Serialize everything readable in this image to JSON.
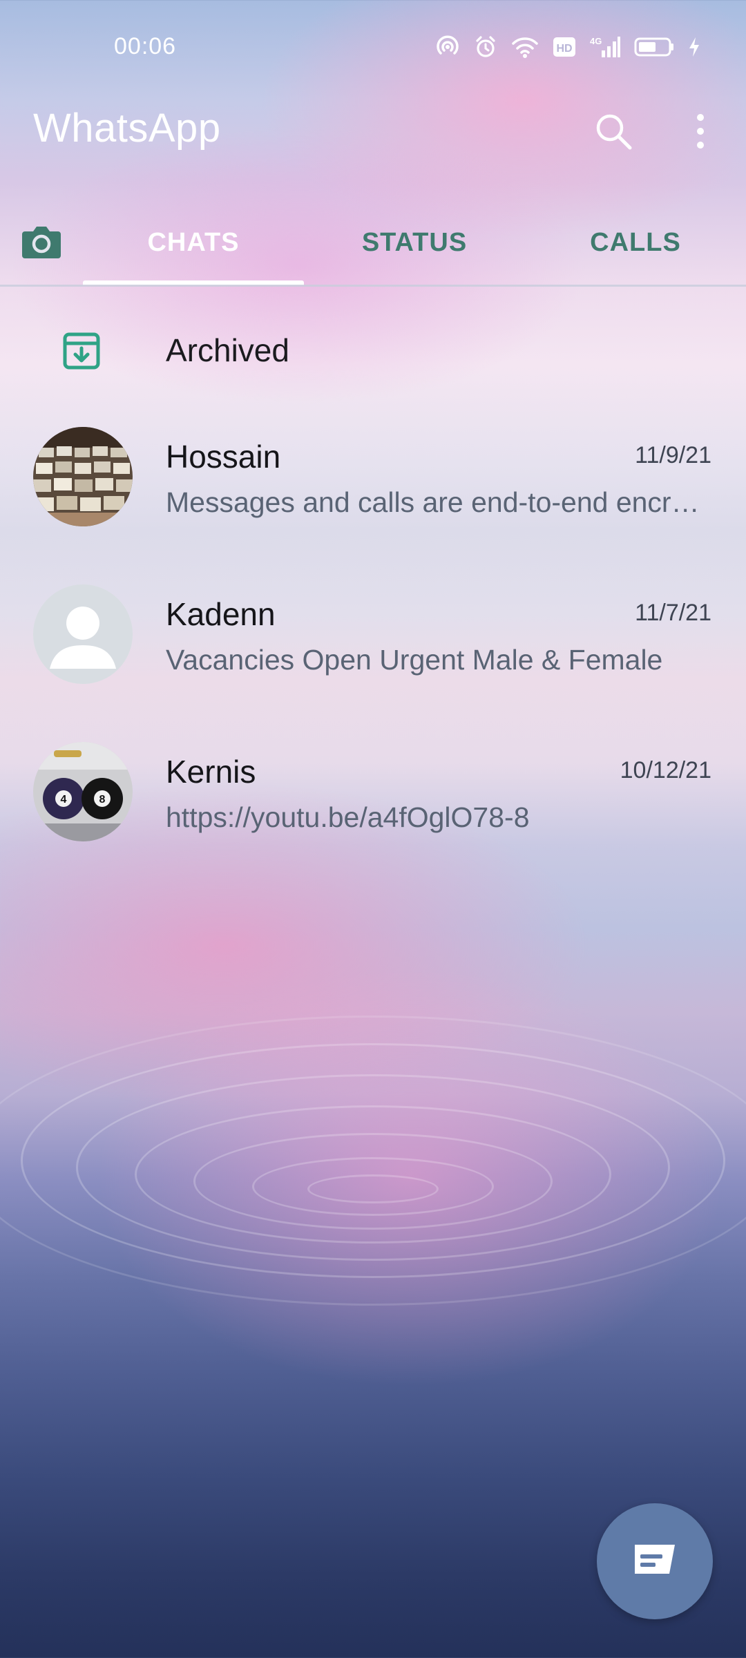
{
  "status_bar": {
    "time": "00:06",
    "network_label": "4G",
    "hd_label": "HD",
    "icons": [
      "hotspot-icon",
      "alarm-icon",
      "wifi-icon",
      "hd-icon",
      "signal-icon",
      "battery-icon",
      "charging-icon"
    ]
  },
  "header": {
    "title": "WhatsApp",
    "icons": [
      "search-icon",
      "more-vertical-icon"
    ]
  },
  "tabs": {
    "camera_icon": "camera-icon",
    "items": [
      {
        "label": "CHATS",
        "active": true
      },
      {
        "label": "STATUS",
        "active": false
      },
      {
        "label": "CALLS",
        "active": false
      }
    ]
  },
  "archived": {
    "label": "Archived",
    "icon": "archive-icon"
  },
  "chats": [
    {
      "name": "Hossain",
      "date": "11/9/21",
      "preview": "Messages and calls are end-to-end encrypted. No one outside of this chat, not even WhatsApp, can read or listen to them.",
      "avatar": "photo"
    },
    {
      "name": "Kadenn",
      "date": "11/7/21",
      "preview": "Vacancies Open Urgent Male & Female",
      "avatar": "default-avatar-icon"
    },
    {
      "name": "Kernis",
      "date": "10/12/21",
      "preview": "https://youtu.be/a4fOglO78-8",
      "avatar": "photo"
    }
  ],
  "fab": {
    "icon": "new-chat-icon"
  },
  "colors": {
    "accent": "#3f7a6e",
    "fab": "#5f7ba8",
    "archive_icon": "#2fa386"
  }
}
